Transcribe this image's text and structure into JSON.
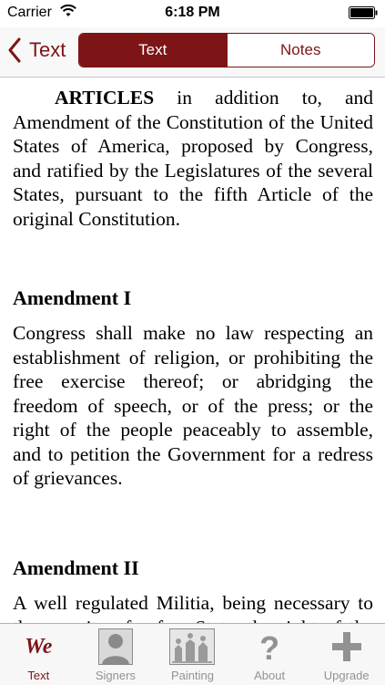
{
  "status_bar": {
    "carrier": "Carrier",
    "time": "6:18 PM"
  },
  "nav": {
    "back_label": "Text",
    "segments": [
      {
        "label": "Text",
        "selected": true
      },
      {
        "label": "Notes",
        "selected": false
      }
    ]
  },
  "content": {
    "intro_lead": "ARTICLES",
    "intro_rest": " in addition to, and Amendment of the Constitution of the United States of America, proposed by Congress, and ratified by the Legislatures of the several States, pursuant to the fifth Article of the original Constitution.",
    "sections": [
      {
        "heading": "Amendment I",
        "body": "Congress shall make no law respecting an establishment of religion, or prohibiting the free exercise thereof; or abridging the freedom of speech, or of the press; or the right of the people peaceably to assemble, and to petition the Government for a redress of grievances."
      },
      {
        "heading": "Amendment II",
        "body": "A well regulated Militia, being necessary to the security of a free State, the right of the people to keep and bear Arms, shall not be infringed."
      }
    ]
  },
  "tab_bar": {
    "tabs": [
      {
        "label": "Text",
        "icon": "we-icon",
        "glyph": "We",
        "selected": true
      },
      {
        "label": "Signers",
        "icon": "signers-icon",
        "selected": false
      },
      {
        "label": "Painting",
        "icon": "painting-icon",
        "selected": false
      },
      {
        "label": "About",
        "icon": "question-mark-icon",
        "glyph": "?",
        "selected": false
      },
      {
        "label": "Upgrade",
        "icon": "plus-icon",
        "glyph": "+",
        "selected": false
      }
    ]
  },
  "colors": {
    "accent": "#7d1416",
    "tab_inactive": "#929292"
  }
}
